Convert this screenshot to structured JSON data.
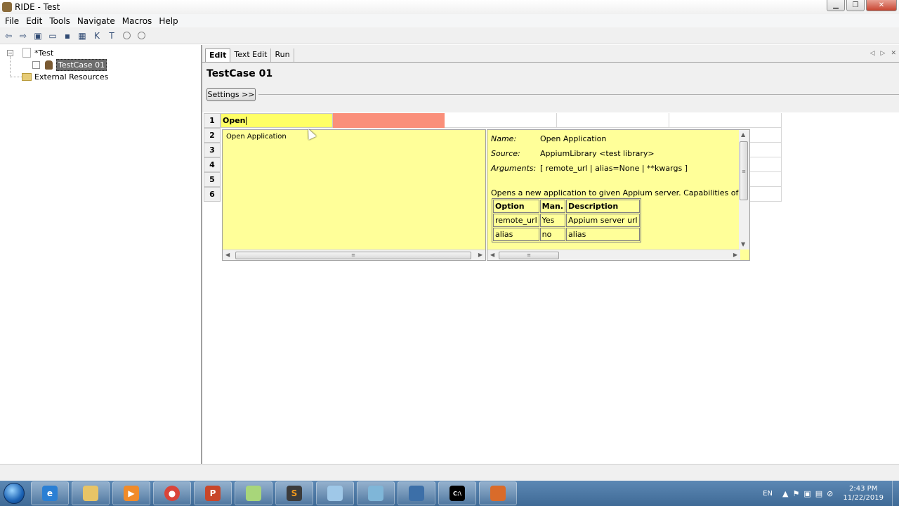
{
  "window": {
    "title": "RIDE - Test"
  },
  "menu": [
    "File",
    "Edit",
    "Tools",
    "Navigate",
    "Macros",
    "Help"
  ],
  "toolbar_icons": [
    "back-icon",
    "forward-icon",
    "open-test-suite-icon",
    "open-directory-icon",
    "save-icon",
    "save-all-icon",
    "search-keywords-icon",
    "search-tests-icon",
    "run-icon",
    "stop-icon"
  ],
  "tree": {
    "root": "*Test",
    "testcase": "TestCase 01",
    "external": "External Resources"
  },
  "tabs": [
    "Edit",
    "Text Edit",
    "Run"
  ],
  "editor": {
    "title": "TestCase 01",
    "settings_label": "Settings >>",
    "row_numbers": [
      "1",
      "2",
      "3",
      "4",
      "5",
      "6"
    ],
    "cell_value": "Open"
  },
  "autocomplete": {
    "item": "Open Application",
    "doc": {
      "name_key": "Name:",
      "name_value": "Open Application",
      "source_key": "Source:",
      "source_value": "AppiumLibrary <test library>",
      "args_key": "Arguments:",
      "args_value": "[ remote_url | alias=None | **kwargs ]",
      "description": "Opens a new application to given Appium server. Capabilities of appiu",
      "table_headers": [
        "Option",
        "Man.",
        "Description"
      ],
      "table_rows": [
        [
          "remote_url",
          "Yes",
          "Appium server url"
        ],
        [
          "alias",
          "no",
          "alias"
        ]
      ]
    }
  },
  "taskbar": {
    "language": "EN",
    "time": "2:43 PM",
    "date": "11/22/2019"
  },
  "colors": {
    "keyword_cell": "#ffff66",
    "error_cell": "#fa8f7a",
    "popup_bg": "#ffff99",
    "taskbar": "#4a76a2"
  }
}
